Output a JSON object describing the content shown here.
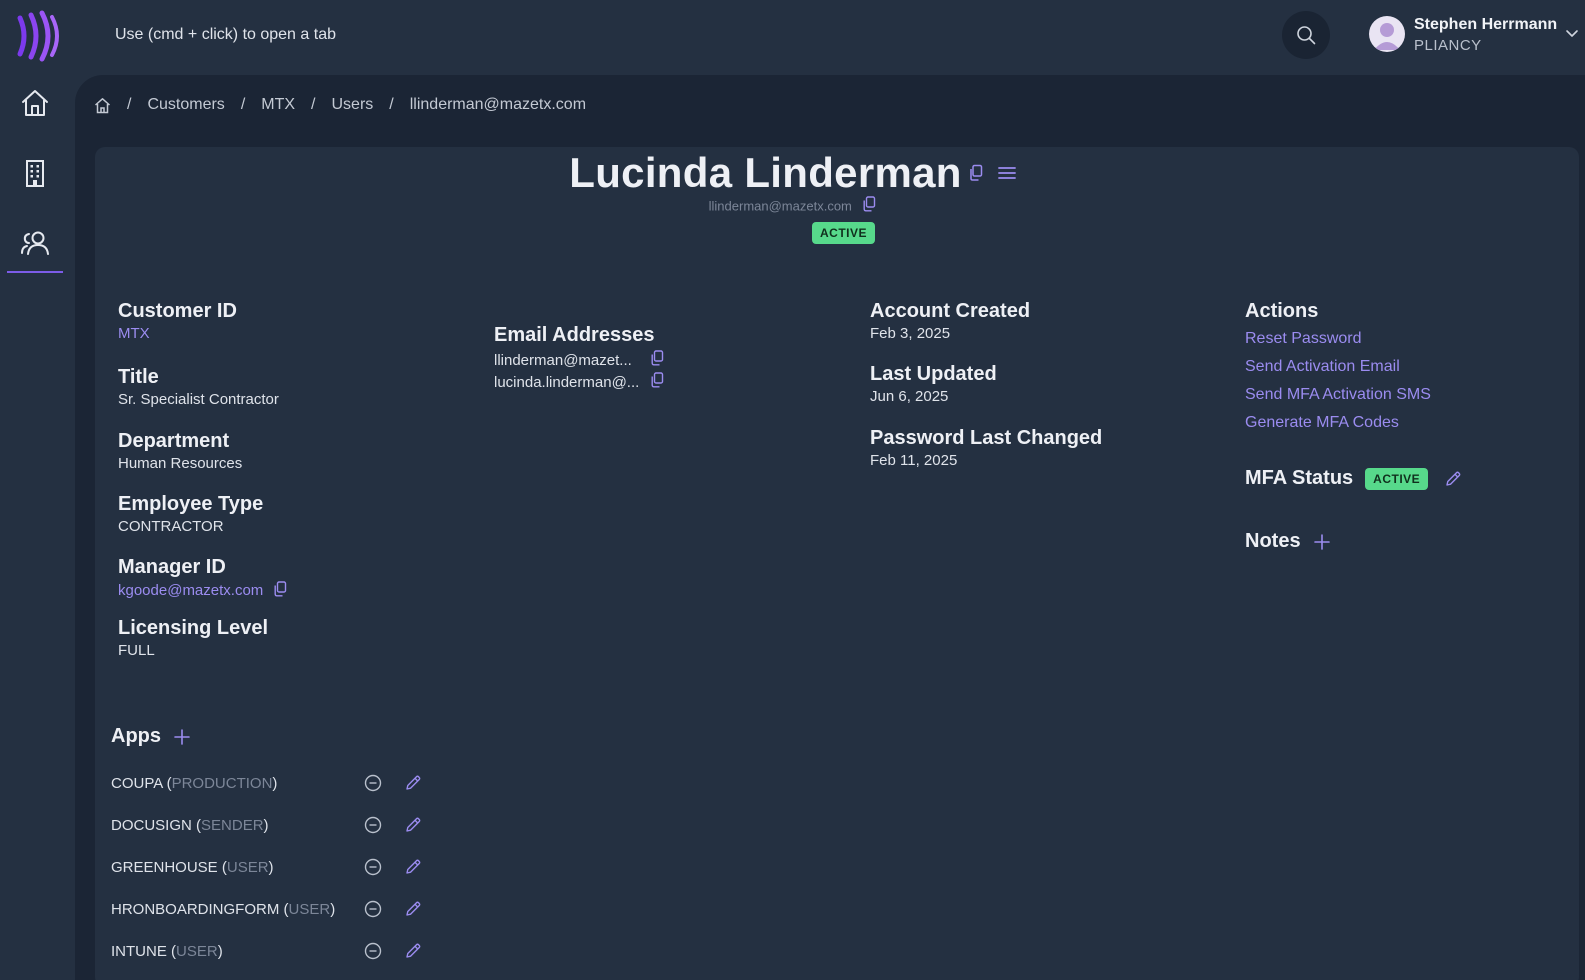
{
  "header": {
    "hint": "Use (cmd + click) to open a tab",
    "user": {
      "name": "Stephen Herrmann",
      "org": "PLIANCY"
    }
  },
  "breadcrumb": {
    "items": [
      "Customers",
      "MTX",
      "Users",
      "llinderman@mazetx.com"
    ],
    "separator": "/"
  },
  "profile": {
    "full_name": "Lucinda Linderman",
    "email": "llinderman@mazetx.com",
    "status": "ACTIVE"
  },
  "details": {
    "customer_id": {
      "label": "Customer ID",
      "value": "MTX"
    },
    "title": {
      "label": "Title",
      "value": "Sr. Specialist Contractor"
    },
    "department": {
      "label": "Department",
      "value": "Human Resources"
    },
    "employee_type": {
      "label": "Employee Type",
      "value": "CONTRACTOR"
    },
    "manager_id": {
      "label": "Manager ID",
      "value": "kgoode@mazetx.com"
    },
    "licensing_level": {
      "label": "Licensing Level",
      "value": "FULL"
    }
  },
  "emails": {
    "label": "Email Addresses",
    "items": [
      "llinderman@mazet...",
      "lucinda.linderman@..."
    ]
  },
  "dates": {
    "account_created": {
      "label": "Account Created",
      "value": "Feb 3, 2025"
    },
    "last_updated": {
      "label": "Last Updated",
      "value": "Jun 6, 2025"
    },
    "password_last_changed": {
      "label": "Password Last Changed",
      "value": "Feb 11, 2025"
    }
  },
  "actions": {
    "label": "Actions",
    "items": [
      "Reset Password",
      "Send Activation Email",
      "Send MFA Activation SMS",
      "Generate MFA Codes"
    ]
  },
  "mfa": {
    "label": "MFA Status",
    "status": "ACTIVE"
  },
  "notes": {
    "label": "Notes"
  },
  "apps": {
    "label": "Apps",
    "items": [
      {
        "name": "COUPA",
        "env": "PRODUCTION"
      },
      {
        "name": "DOCUSIGN",
        "env": "SENDER"
      },
      {
        "name": "GREENHOUSE",
        "env": "USER"
      },
      {
        "name": "HRONBOARDINGFORM",
        "env": "USER"
      },
      {
        "name": "INTUNE",
        "env": "USER"
      }
    ]
  },
  "colors": {
    "accent": "#9b8cf0",
    "status_green": "#57d98b",
    "background": "#243041",
    "panel": "#1b2535"
  }
}
